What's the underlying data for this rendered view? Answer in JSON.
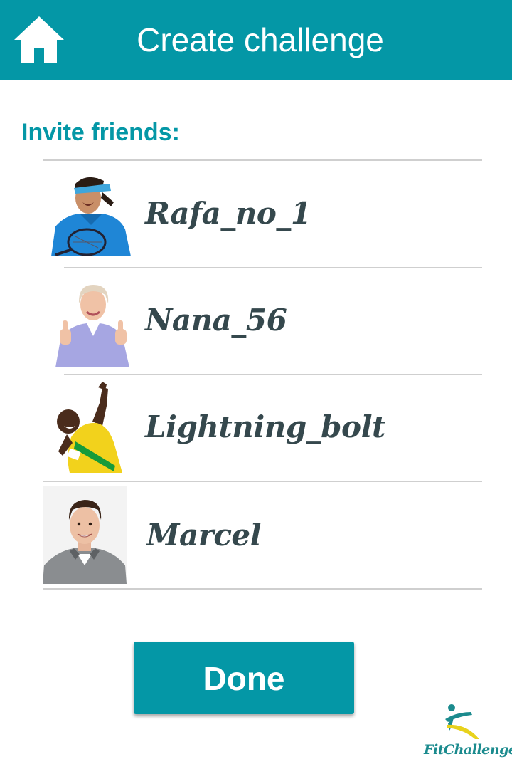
{
  "header": {
    "title": "Create challenge",
    "home_icon": "home-icon",
    "background": "#0497a6"
  },
  "invite": {
    "label": "Invite friends:",
    "friends": [
      {
        "name": "Rafa_no_1",
        "avatar": "tennis-player-avatar"
      },
      {
        "name": "Nana_56",
        "avatar": "grandmother-thumbs-up-avatar"
      },
      {
        "name": "Lightning_bolt",
        "avatar": "sprinter-avatar"
      },
      {
        "name": "Marcel",
        "avatar": "skier-portrait-avatar"
      }
    ]
  },
  "actions": {
    "done_label": "Done"
  },
  "brand": {
    "name": "FitChallenger",
    "accent": "#0497a6",
    "logo_colors": [
      "#1b8b8e",
      "#e8d21c"
    ]
  }
}
